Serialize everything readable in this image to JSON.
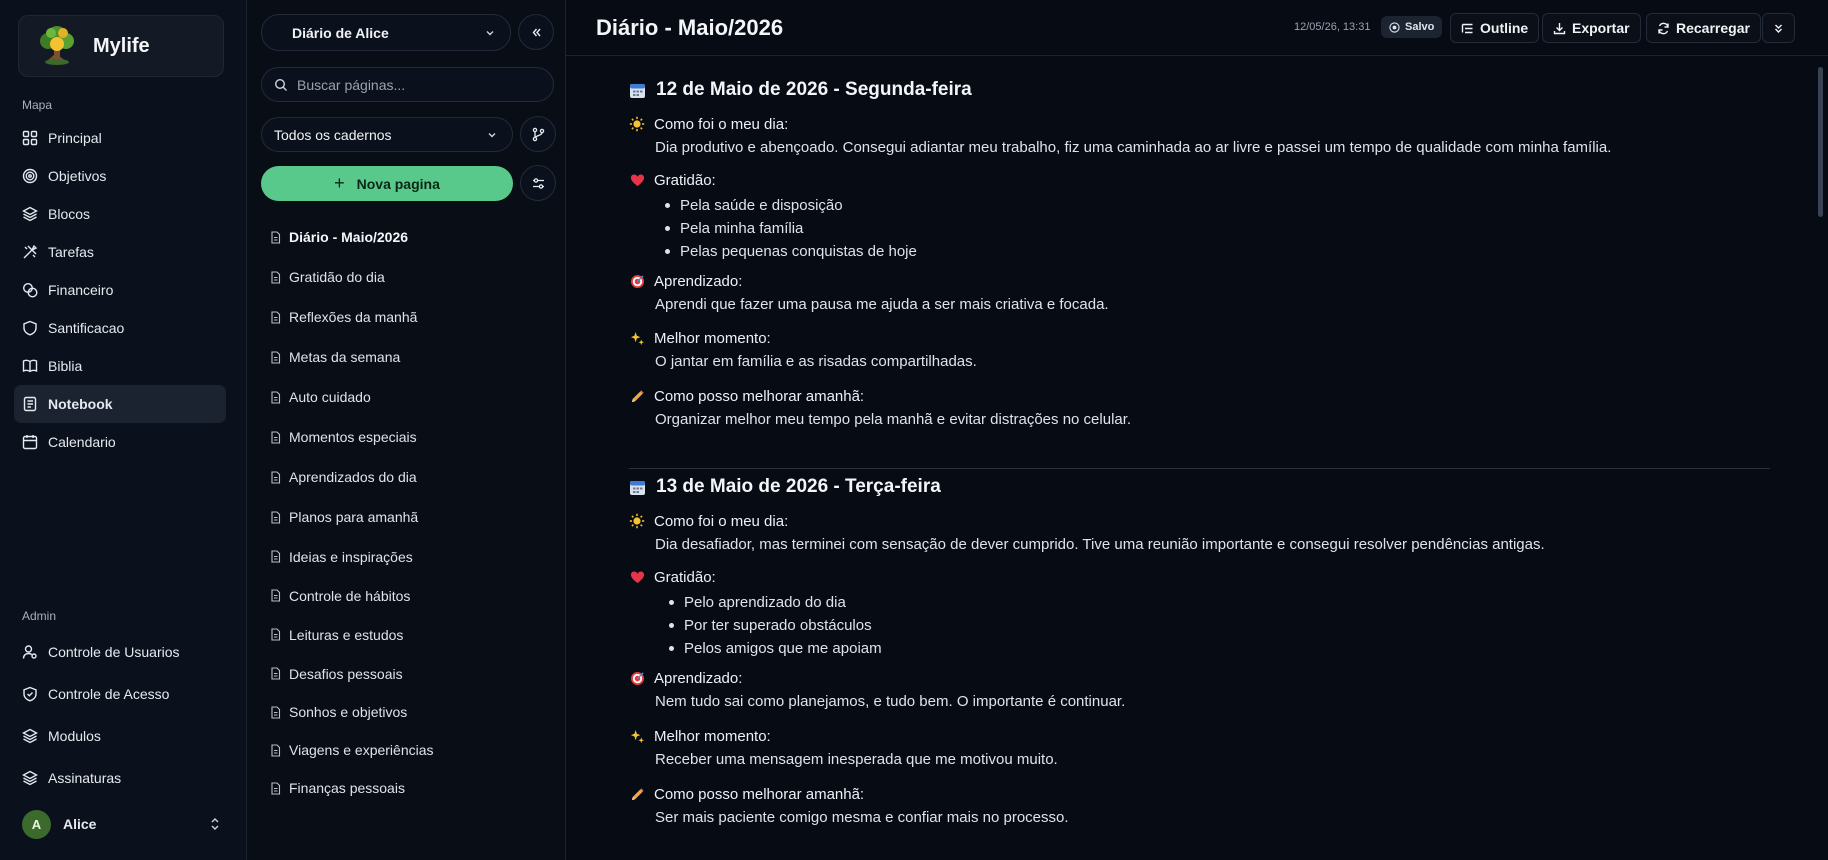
{
  "brand": {
    "name": "Mylife"
  },
  "nav": {
    "section_map": "Mapa",
    "items": [
      {
        "label": "Principal",
        "icon": "grid-icon"
      },
      {
        "label": "Objetivos",
        "icon": "target-icon"
      },
      {
        "label": "Blocos",
        "icon": "layers-icon"
      },
      {
        "label": "Tarefas",
        "icon": "tools-icon"
      },
      {
        "label": "Financeiro",
        "icon": "coins-icon"
      },
      {
        "label": "Santificacao",
        "icon": "shield-icon"
      },
      {
        "label": "Biblia",
        "icon": "book-icon"
      },
      {
        "label": "Notebook",
        "icon": "notebook-icon"
      },
      {
        "label": "Calendario",
        "icon": "calendar-icon"
      }
    ],
    "section_admin": "Admin",
    "admin_items": [
      {
        "label": "Controle de Usuarios",
        "icon": "user-cog-icon"
      },
      {
        "label": "Controle de Acesso",
        "icon": "shield-check-icon"
      },
      {
        "label": "Modulos",
        "icon": "layers-icon"
      },
      {
        "label": "Assinaturas",
        "icon": "layers-icon"
      }
    ],
    "user": {
      "initial": "A",
      "name": "Alice"
    }
  },
  "pages_panel": {
    "notebook_select": "Diário de Alice",
    "search_placeholder": "Buscar páginas...",
    "filter_select": "Todos os cadernos",
    "new_page_label": "Nova pagina",
    "items": [
      "Diário - Maio/2026",
      "Gratidão do dia",
      "Reflexões da manhã",
      "Metas da semana",
      "Auto cuidado",
      "Momentos especiais",
      "Aprendizados do dia",
      "Planos para amanhã",
      "Ideias e inspirações",
      "Controle de hábitos",
      "Leituras e estudos",
      "Desafios pessoais",
      "Sonhos e objetivos",
      "Viagens e experiências",
      "Finanças pessoais"
    ]
  },
  "header": {
    "title": "Diário - Maio/2026",
    "timestamp": "12/05/26, 13:31",
    "saved": "Salvo",
    "outline": "Outline",
    "export": "Exportar",
    "reload": "Recarregar"
  },
  "entries": [
    {
      "heading": "12 de Maio de 2026 - Segunda-feira",
      "day_title": "Como foi o meu dia:",
      "day_text": "Dia produtivo e abençoado. Consegui adiantar meu trabalho, fiz uma caminhada ao ar livre e passei um tempo de qualidade com minha família.",
      "gratitude_title": "Gratidão:",
      "gratitude_items": [
        "Pela saúde e disposição",
        "Pela minha família",
        "Pelas pequenas conquistas de hoje"
      ],
      "learning_title": "Aprendizado:",
      "learning_text": "Aprendi que fazer uma pausa me ajuda a ser mais criativa e focada.",
      "best_title": "Melhor momento:",
      "best_text": "O jantar em família e as risadas compartilhadas.",
      "improve_title": "Como posso melhorar amanhã:",
      "improve_text": "Organizar melhor meu tempo pela manhã e evitar distrações no celular."
    },
    {
      "heading": "13 de Maio de 2026 - Terça-feira",
      "day_title": "Como foi o meu dia:",
      "day_text": "Dia desafiador, mas terminei com sensação de dever cumprido. Tive uma reunião importante e consegui resolver pendências antigas.",
      "gratitude_title": "Gratidão:",
      "gratitude_items": [
        "Pelo aprendizado do dia",
        "Por ter superado obstáculos",
        "Pelos amigos que me apoiam"
      ],
      "learning_title": "Aprendizado:",
      "learning_text": "Nem tudo sai como planejamos, e tudo bem. O importante é continuar.",
      "best_title": "Melhor momento:",
      "best_text": "Receber uma mensagem inesperada que me motivou muito.",
      "improve_title": "Como posso melhorar amanhã:",
      "improve_text": "Ser mais paciente comigo mesma e confiar mais no processo."
    }
  ],
  "colors": {
    "accent": "#58c98a",
    "background": "#060b14",
    "sidebar": "#0b111c"
  }
}
